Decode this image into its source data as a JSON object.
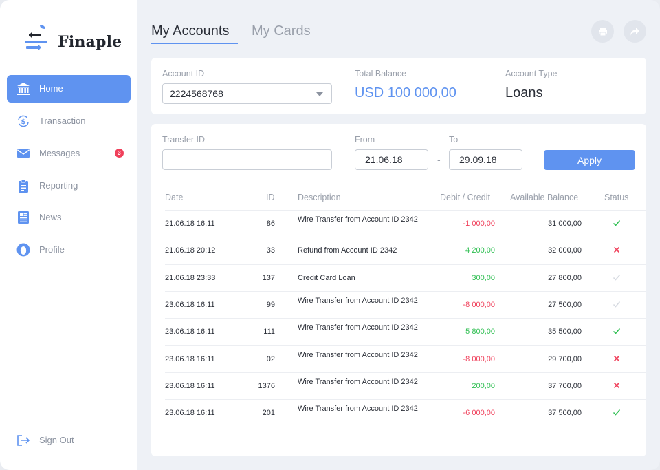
{
  "brand": {
    "name": "Finaple"
  },
  "sidebar": {
    "items": [
      {
        "label": "Home",
        "icon": "bank-icon",
        "active": true
      },
      {
        "label": "Transaction",
        "icon": "dollar-exchange-icon",
        "active": false
      },
      {
        "label": "Messages",
        "icon": "envelope-icon",
        "active": false,
        "badge": "3"
      },
      {
        "label": "Reporting",
        "icon": "clipboard-icon",
        "active": false
      },
      {
        "label": "News",
        "icon": "newspaper-icon",
        "active": false
      },
      {
        "label": "Profile",
        "icon": "user-icon",
        "active": false
      }
    ],
    "signout": {
      "label": "Sign Out",
      "icon": "sign-out-icon"
    }
  },
  "tabs": [
    {
      "label": "My Accounts",
      "active": true
    },
    {
      "label": "My Cards",
      "active": false
    }
  ],
  "toolbar": {
    "print_icon": "print-icon",
    "share_icon": "share-icon"
  },
  "account": {
    "id_label": "Account ID",
    "id_value": "2224568768",
    "balance_label": "Total Balance",
    "balance_value": "USD 100 000,00",
    "type_label": "Account Type",
    "type_value": "Loans"
  },
  "filter": {
    "transfer_label": "Transfer ID",
    "transfer_value": "",
    "from_label": "From",
    "from_value": "21.06.18",
    "to_label": "To",
    "to_value": "29.09.18",
    "dash": "-",
    "apply_label": "Apply"
  },
  "table": {
    "headers": {
      "date": "Date",
      "id": "ID",
      "description": "Description",
      "debit_credit": "Debit / Credit",
      "available_balance": "Available Balance",
      "status": "Status"
    },
    "rows": [
      {
        "date": "21.06.18 16:11",
        "id": "86",
        "description": "Wire Transfer from Account ID 2342",
        "amount": "-1 000,00",
        "sign": "neg",
        "balance": "31 000,00",
        "status": "success"
      },
      {
        "date": "21.06.18 20:12",
        "id": "33",
        "description": "Refund from Account ID 2342",
        "amount": "4 200,00",
        "sign": "pos",
        "balance": "32 000,00",
        "status": "failed"
      },
      {
        "date": "21.06.18 23:33",
        "id": "137",
        "description": "Credit Card Loan",
        "amount": "300,00",
        "sign": "pos",
        "balance": "27 800,00",
        "status": "pending"
      },
      {
        "date": "23.06.18 16:11",
        "id": "99",
        "description": "Wire Transfer from Account ID 2342",
        "amount": "-8 000,00",
        "sign": "neg",
        "balance": "27 500,00",
        "status": "pending"
      },
      {
        "date": "23.06.18 16:11",
        "id": "111",
        "description": "Wire Transfer from Account ID 2342",
        "amount": "5 800,00",
        "sign": "pos",
        "balance": "35 500,00",
        "status": "success"
      },
      {
        "date": "23.06.18 16:11",
        "id": "02",
        "description": "Wire Transfer from Account ID 2342",
        "amount": "-8 000,00",
        "sign": "neg",
        "balance": "29 700,00",
        "status": "failed"
      },
      {
        "date": "23.06.18 16:11",
        "id": "1376",
        "description": "Wire Transfer from Account ID 2342",
        "amount": "200,00",
        "sign": "pos",
        "balance": "37 700,00",
        "status": "failed"
      },
      {
        "date": "23.06.18 16:11",
        "id": "201",
        "description": "Wire Transfer from Account ID 2342",
        "amount": "-6 000,00",
        "sign": "neg",
        "balance": "37 500,00",
        "status": "success"
      }
    ]
  },
  "colors": {
    "accent": "#5f93f0",
    "negative": "#f0405b",
    "positive": "#2fbf52",
    "muted": "#d5d9e0"
  }
}
